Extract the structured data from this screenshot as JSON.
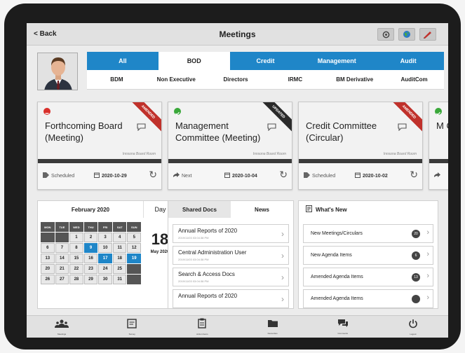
{
  "colors": {
    "accent": "#1f86c8",
    "ribbon_amended": "#c0312b",
    "ribbon_updated": "#2a2a2a",
    "status_red": "#d9302b",
    "status_green": "#3aa83a"
  },
  "header": {
    "back_label": "< Back",
    "title": "Meetings",
    "icons": [
      "gear-icon",
      "globe-icon",
      "pen-icon"
    ]
  },
  "filters": {
    "primary": [
      {
        "label": "All",
        "active": false
      },
      {
        "label": "BOD",
        "active": true
      },
      {
        "label": "Credit",
        "active": false
      },
      {
        "label": "Management",
        "active": false
      },
      {
        "label": "Audit",
        "active": false
      }
    ],
    "secondary": [
      "BDM",
      "Non Executive",
      "Directors",
      "IRMC",
      "BM Derivative",
      "AuditCom"
    ]
  },
  "cards": [
    {
      "title": "Forthcoming Board (Meeting)",
      "ribbon": "AMENDED",
      "room": "Innsona Board Room",
      "status": "Scheduled",
      "date": "2020-10-29",
      "dot_icon": "minus-circle-icon"
    },
    {
      "title": "Management Committee (Meeting)",
      "ribbon": "UPDATED",
      "room": "Innsona Board Room",
      "status": "Next",
      "date": "2020-10-04",
      "dot_icon": "check-circle-icon"
    },
    {
      "title": "Credit Committee (Circular)",
      "ribbon": "AMENDED",
      "room": "Innsona Board Room",
      "status": "Scheduled",
      "date": "2020-10-02",
      "dot_icon": ""
    },
    {
      "title": "M C",
      "ribbon": "",
      "room": "",
      "status": "",
      "date": "",
      "dot_icon": "check-circle-icon"
    }
  ],
  "calendar": {
    "month": "February 2020",
    "day_label": "Day",
    "weekdays": [
      "MON",
      "TUE",
      "WED",
      "THU",
      "FRI",
      "SAT",
      "SUN"
    ],
    "weeks": [
      [
        "",
        "",
        "1",
        "2",
        "3",
        "4",
        "5"
      ],
      [
        "6",
        "7",
        "8",
        "9",
        "10",
        "11",
        "12"
      ],
      [
        "13",
        "14",
        "15",
        "16",
        "17",
        "18",
        "19"
      ],
      [
        "20",
        "21",
        "22",
        "23",
        "24",
        "25",
        ""
      ],
      [
        "26",
        "27",
        "28",
        "29",
        "30",
        "31",
        ""
      ]
    ],
    "selected_days": [
      "9",
      "17",
      "19"
    ],
    "big_day": "18",
    "big_month": "May 2020"
  },
  "docs": {
    "tabs": [
      "Shared Docs",
      "News"
    ],
    "items": [
      {
        "name": "Annual Reports of 2020",
        "date": "2019/11/03 03:04:38 PM"
      },
      {
        "name": "Central Administration User",
        "date": "2019/11/03 03:04:38 PM"
      },
      {
        "name": "Search & Access Docs",
        "date": "2019/11/03 03:04:38 PM"
      },
      {
        "name": "Annual Reports of 2020",
        "date": ""
      }
    ]
  },
  "whats_new": {
    "title": "What's New",
    "items": [
      {
        "label": "New Meetings/Circulars",
        "count": "20"
      },
      {
        "label": "New Agenda Items",
        "count": "6"
      },
      {
        "label": "Amended Agenda Items",
        "count": "13"
      },
      {
        "label": "Amended Agenda Items",
        "count": ""
      }
    ]
  },
  "bottom_nav": [
    {
      "label": "Meetings",
      "icon": "people-icon"
    },
    {
      "label": "Survey",
      "icon": "survey-icon"
    },
    {
      "label": "Action Items",
      "icon": "clipboard-icon"
    },
    {
      "label": "Favourites",
      "icon": "folder-icon"
    },
    {
      "label": "Comments",
      "icon": "comments-icon"
    },
    {
      "label": "Logout",
      "icon": "power-icon"
    }
  ]
}
